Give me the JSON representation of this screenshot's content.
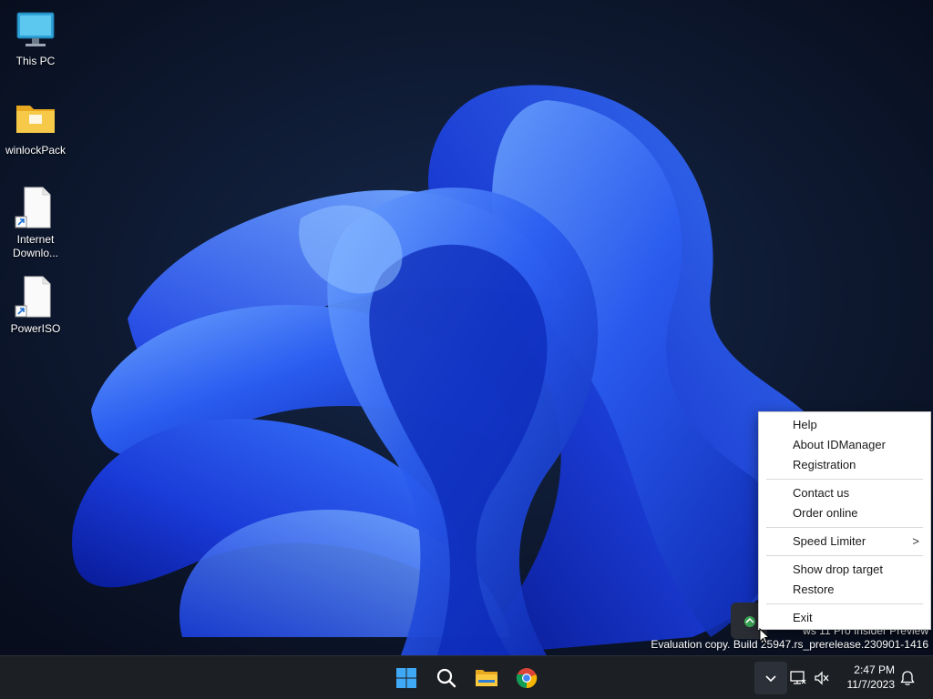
{
  "desktop": {
    "icons": [
      {
        "label": "This PC",
        "icon": "monitor-icon"
      },
      {
        "label": "winlockPack",
        "icon": "folder-icon"
      },
      {
        "label": "Internet Downlo...",
        "icon": "shortcut-file-icon"
      },
      {
        "label": "PowerISO",
        "icon": "shortcut-file-icon"
      }
    ]
  },
  "context_menu": {
    "items": [
      {
        "label": "Help"
      },
      {
        "label": "About IDManager"
      },
      {
        "label": "Registration"
      },
      {
        "label": "Contact us"
      },
      {
        "label": "Order online"
      },
      {
        "label": "Speed Limiter",
        "submenu_arrow": ">"
      },
      {
        "label": "Show drop target"
      },
      {
        "label": "Restore"
      },
      {
        "label": "Exit"
      }
    ]
  },
  "watermark": {
    "line1": "ws 11 Pro Insider Preview",
    "line2": "Evaluation copy. Build 25947.rs_prerelease.230901-1416"
  },
  "taskbar": {
    "pinned": [
      "windows-start-icon",
      "search-icon",
      "file-explorer-icon",
      "chrome-icon"
    ],
    "tray": {
      "overflow_icon": "chevron-up-icon",
      "network_icon": "network-icon",
      "volume_icon": "volume-muted-icon",
      "notification_icon": "bell-icon"
    },
    "clock": {
      "time": "2:47 PM",
      "date": "11/7/2023"
    }
  },
  "colors": {
    "accent": "#2a63f5",
    "taskbar": "#1c1f24",
    "wallpaper_dark": "#0a1224"
  }
}
